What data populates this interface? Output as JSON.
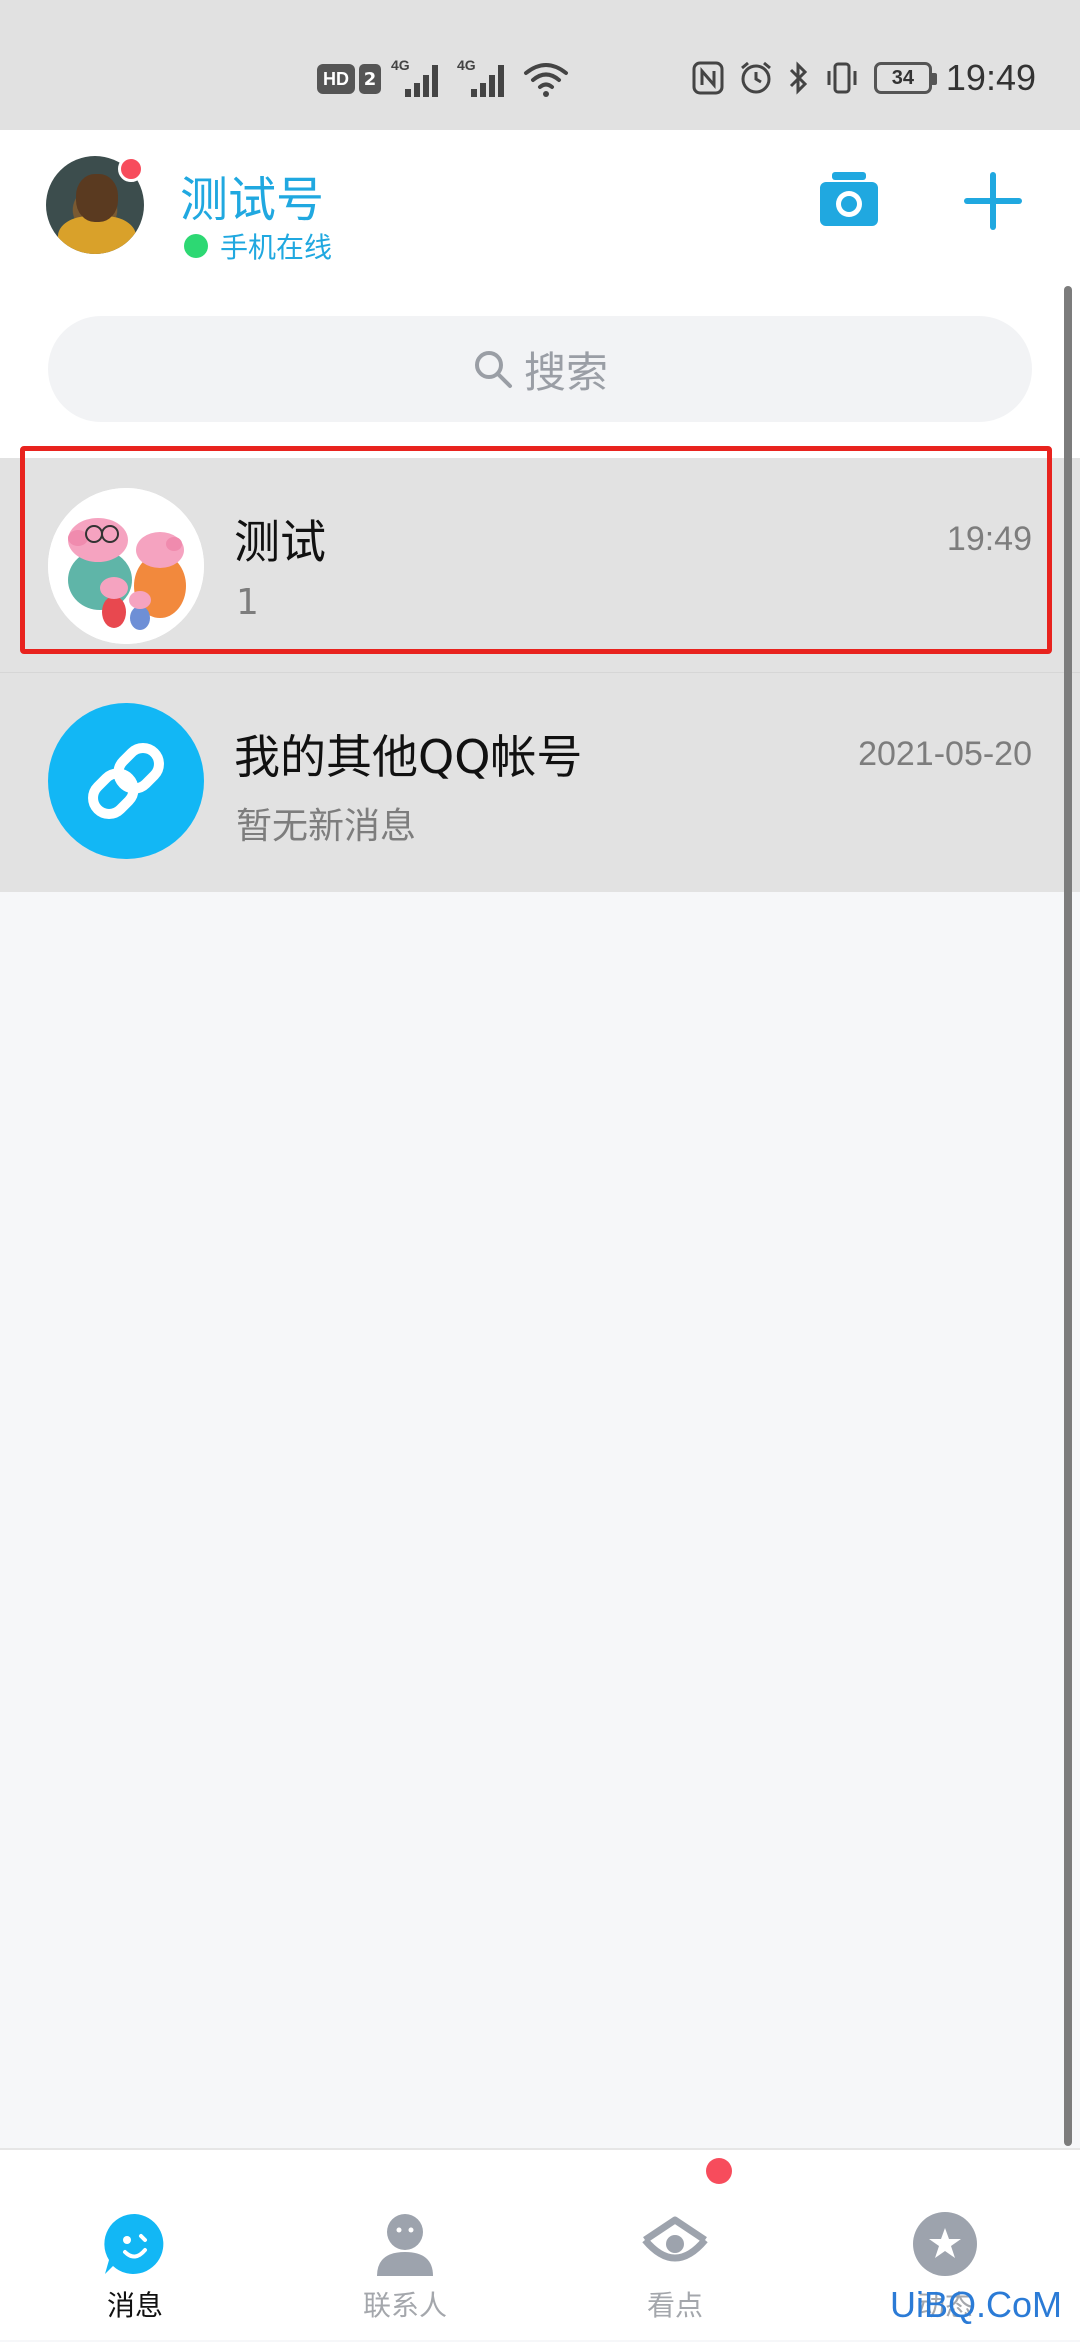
{
  "status_bar": {
    "hd_label": "HD",
    "hd_slot": "2",
    "signal_1_label": "4G",
    "signal_2_label": "4G",
    "battery_level": "34",
    "time": "19:49"
  },
  "header": {
    "account_name": "测试号",
    "online_status": "手机在线",
    "has_notification_dot": true,
    "camera_icon": "camera-icon",
    "add_icon": "plus-icon"
  },
  "search": {
    "placeholder": "搜索",
    "icon": "search-icon"
  },
  "chats": [
    {
      "title": "测试",
      "preview": "1",
      "time": "19:49",
      "highlighted": true
    },
    {
      "title": "我的其他QQ帐号",
      "preview": "暂无新消息",
      "time": "2021-05-20",
      "icon": "link-icon"
    }
  ],
  "tabs": [
    {
      "label": "消息",
      "icon": "message-icon",
      "active": true
    },
    {
      "label": "联系人",
      "icon": "contacts-icon",
      "active": false
    },
    {
      "label": "看点",
      "icon": "eye-icon",
      "active": false,
      "badge": true
    },
    {
      "label": "动态",
      "icon": "star-icon",
      "active": false
    }
  ],
  "watermark": "UiBQ.CoM",
  "colors": {
    "brand_blue": "#12B7F5",
    "header_text": "#20A8E0",
    "online_green": "#2DD873",
    "badge_red": "#F74C5C",
    "highlight_red": "#E8231E"
  }
}
